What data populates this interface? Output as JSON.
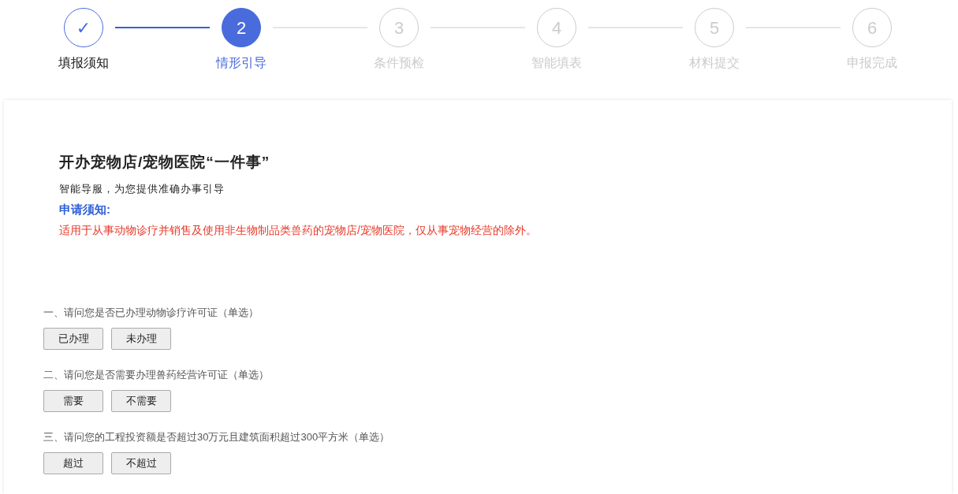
{
  "steps": [
    {
      "number": "✓",
      "label": "填报须知",
      "completed": true,
      "selected": false
    },
    {
      "number": "2",
      "label": "情形引导",
      "completed": false,
      "selected": true
    },
    {
      "number": "3",
      "label": "条件预检",
      "completed": false,
      "selected": false
    },
    {
      "number": "4",
      "label": "智能填表",
      "completed": false,
      "selected": false
    },
    {
      "number": "5",
      "label": "材料提交",
      "completed": false,
      "selected": false
    },
    {
      "number": "6",
      "label": "申报完成",
      "completed": false,
      "selected": false
    }
  ],
  "title": "开办宠物店/宠物医院“一件事”",
  "subtitle": "智能导服，为您提供准确办事引导",
  "notice": {
    "heading": "申请须知:",
    "text": "适用于从事动物诊疗并销售及使用非生物制品类兽药的宠物店/宠物医院，仅从事宠物经营的除外。"
  },
  "questions": [
    {
      "text": "一、请问您是否已办理动物诊疗许可证（单选）",
      "options": [
        {
          "label": "已办理",
          "selected": false
        },
        {
          "label": "未办理",
          "selected": false
        }
      ]
    },
    {
      "text": "二、请问您是否需要办理兽药经营许可证（单选）",
      "options": [
        {
          "label": "需要",
          "selected": false
        },
        {
          "label": "不需要",
          "selected": false
        }
      ]
    },
    {
      "text": "三、请问您的工程投资额是否超过30万元且建筑面积超过300平方米（单选）",
      "options": [
        {
          "label": "超过",
          "selected": false
        },
        {
          "label": "不超过",
          "selected": false
        }
      ]
    }
  ]
}
